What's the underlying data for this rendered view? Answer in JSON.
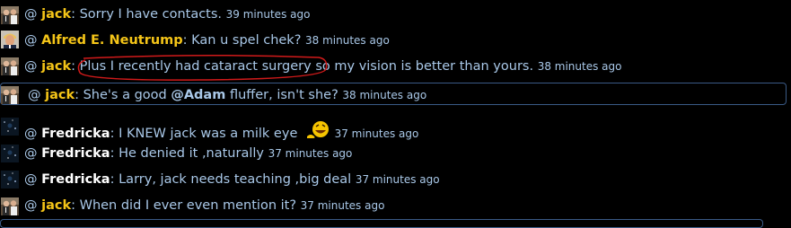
{
  "messages": [
    {
      "avatar": "couple-photo-avatar",
      "at": "@",
      "user": "jack",
      "text": ": Sorry I have contacts.",
      "time": "39 minutes ago"
    },
    {
      "avatar": "politician-photo-avatar",
      "at": "@",
      "user": "Alfred E. Neutrump",
      "text": ": Kan u spel chek?",
      "time": "38 minutes ago"
    },
    {
      "avatar": "couple-photo-avatar",
      "at": "@",
      "user": "jack",
      "text_sep": ":",
      "text_circled": "Plus I recently had cataract surgery",
      "text_rest": "so my vision is better than yours.",
      "time": "38 minutes ago"
    },
    {
      "avatar": "couple-photo-avatar",
      "at": "@",
      "user": "jack",
      "text_a": ": She's a good",
      "mention": "@Adam",
      "text_b": "fluffer, isn't she?",
      "time": "38 minutes ago"
    },
    {
      "avatar": "starfield-avatar",
      "at": "@",
      "user": "Fredricka",
      "text": ": I KNEW jack was a milk eye",
      "time": "37 minutes ago"
    },
    {
      "avatar": "starfield-avatar",
      "at": "@",
      "user": "Fredricka",
      "text": ": He denied it ,naturally",
      "time": "37 minutes ago"
    },
    {
      "avatar": "starfield-avatar",
      "at": "@",
      "user": "Fredricka",
      "text": ": Larry, jack needs teaching ,big deal",
      "time": "37 minutes ago"
    },
    {
      "avatar": "couple-photo-avatar",
      "at": "@",
      "user": "jack",
      "text": ": When did I ever even mention it?",
      "time": "37 minutes ago"
    }
  ],
  "colors": {
    "background": "#000000",
    "text": "#a9c8e8",
    "user_gold": "#f5c518",
    "user_white": "#ffffff",
    "circle": "#d11a1a",
    "border": "#3a5a86"
  },
  "emoji": "laughing-emoji"
}
